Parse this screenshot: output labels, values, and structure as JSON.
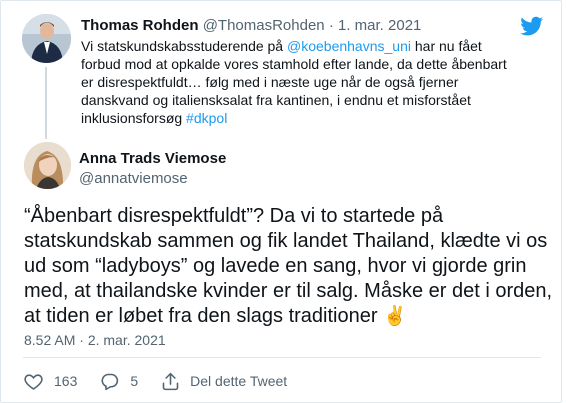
{
  "quoted_tweet": {
    "display_name": "Thomas Rohden",
    "handle": "@ThomasRohden",
    "separator": " · ",
    "date": "1. mar. 2021",
    "text_part1": "Vi statskundskabsstuderende på ",
    "mention": "@koebenhavns_uni",
    "text_part2": " har nu fået forbud mod at opkalde vores stamhold efter lande, da dette åbenbart er disrespektfuldt… følg med i næste uge når de også fjerner danskvand og italiensksalat fra kantinen, i endnu et misforstået inklusionsforsøg ",
    "hashtag": "#dkpol"
  },
  "main_tweet": {
    "display_name": "Anna Trads Viemose",
    "handle": "@annatviemose",
    "text": "“Åbenbart disrespektfuldt”? Da vi to startede på statskundskab sammen og fik landet Thailand, klædte vi os ud som “ladyboys” og lavede en sang, hvor vi gjorde grin med, at thailandske kvinder er til salg. Måske er det i orden, at tiden er løbet fra den slags traditioner ",
    "emoji": "✌️",
    "time": "8.52 AM",
    "time_separator": " · ",
    "date": "2. mar. 2021"
  },
  "actions": {
    "likes": "163",
    "replies": "5",
    "share_label": "Del dette Tweet"
  },
  "icons": {
    "brand": "twitter-bird-icon",
    "like": "heart-icon",
    "reply": "reply-bubble-icon",
    "share": "share-icon"
  },
  "colors": {
    "brand_blue": "#1d9bf0",
    "text": "#0f1419",
    "secondary": "#536471",
    "border": "#e1e8ed"
  }
}
